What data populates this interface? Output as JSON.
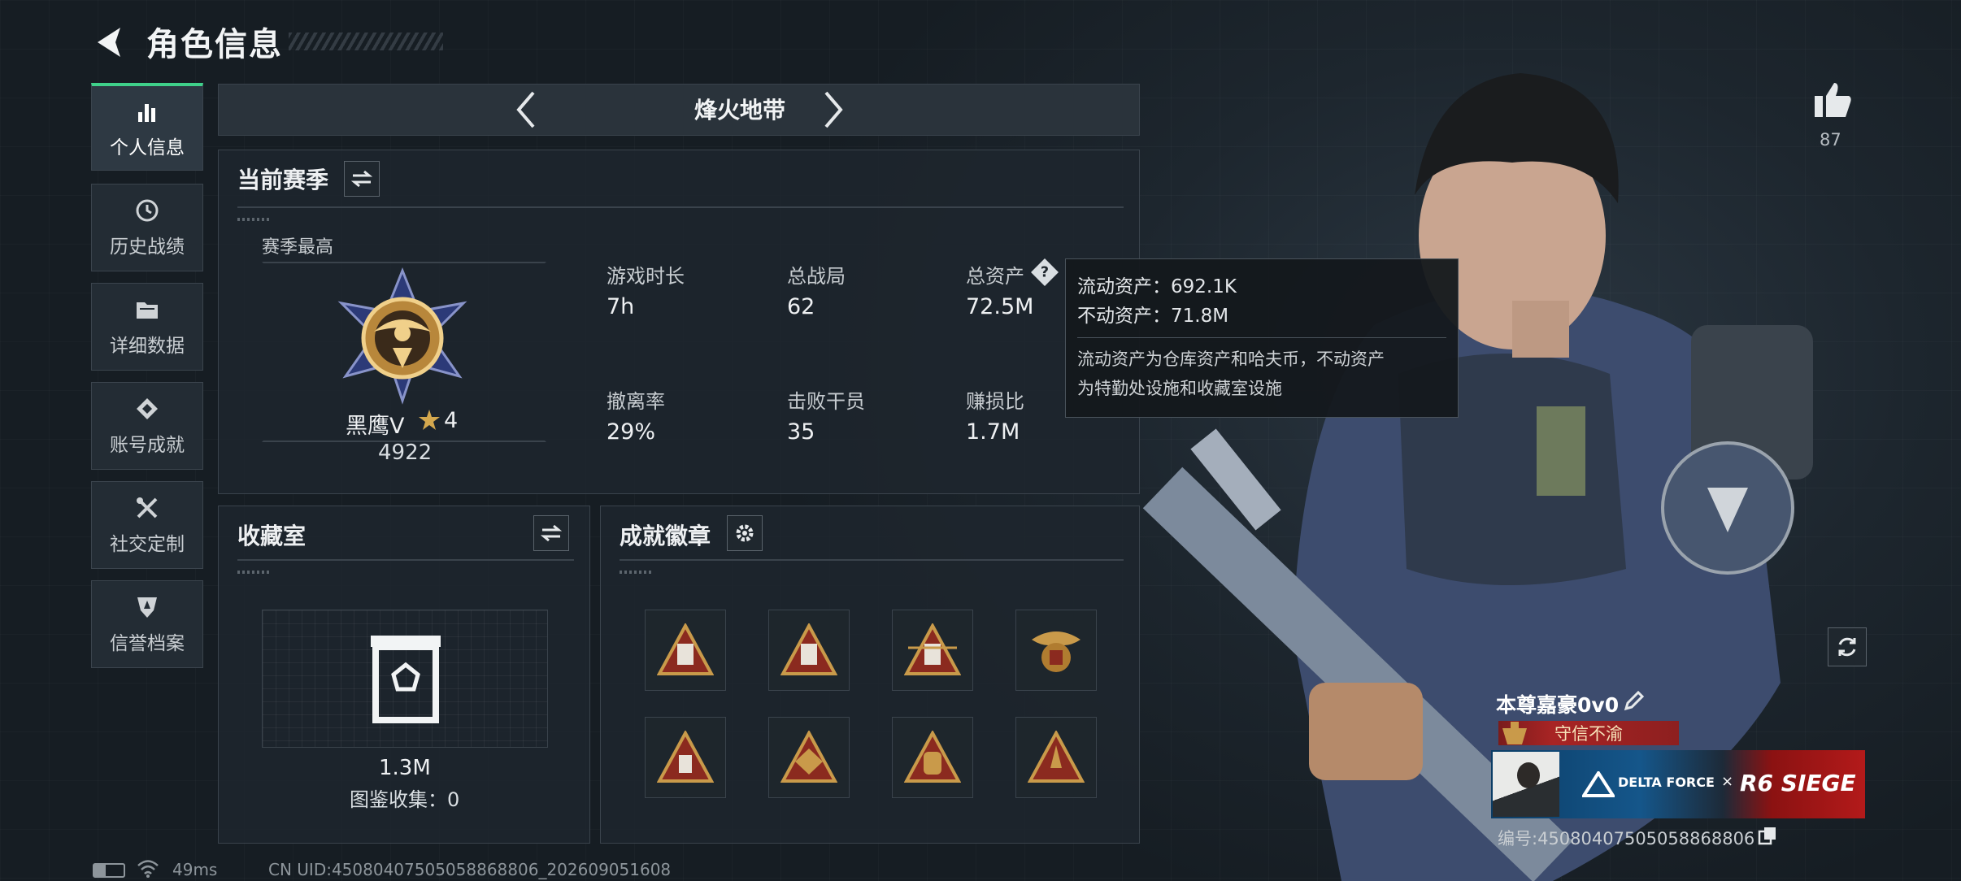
{
  "header": {
    "title": "角色信息"
  },
  "sidebar": {
    "items": [
      {
        "label": "个人信息",
        "icon": "bar-chart-icon",
        "active": true
      },
      {
        "label": "历史战绩",
        "icon": "history-clock-icon"
      },
      {
        "label": "详细数据",
        "icon": "folder-icon"
      },
      {
        "label": "账号成就",
        "icon": "achievement-icon"
      },
      {
        "label": "社交定制",
        "icon": "tools-icon"
      },
      {
        "label": "信誉档案",
        "icon": "shield-icon"
      }
    ]
  },
  "mode": {
    "name": "烽火地带"
  },
  "season": {
    "title": "当前赛季",
    "best_label": "赛季最高",
    "rank_name": "黑鹰V",
    "rank_stars": "4",
    "rank_score": "4922",
    "stats": [
      {
        "label": "游戏时长",
        "value": "7h"
      },
      {
        "label": "总战局",
        "value": "62"
      },
      {
        "label": "总资产",
        "value": "72.5M"
      },
      {
        "label": "撤离率",
        "value": "29%"
      },
      {
        "label": "击败干员",
        "value": "35"
      },
      {
        "label": "赚损比",
        "value": "1.7M"
      }
    ]
  },
  "tooltip": {
    "liquid": "流动资产：692.1K",
    "fixed": "不动资产：71.8M",
    "desc_line1": "流动资产为仓库资产和哈夫币，不动资产",
    "desc_line2": "为特勤处设施和收藏室设施"
  },
  "collection": {
    "title": "收藏室",
    "value": "1.3M",
    "catalog": "图鉴收集：0"
  },
  "badges": {
    "title": "成就徽章",
    "items": [
      "57",
      "58",
      "59",
      "eagle",
      "",
      "",
      "",
      ""
    ]
  },
  "likes": {
    "count": "87"
  },
  "profile": {
    "name": "本尊嘉豪0v0",
    "honor": "守信不渝",
    "banner_left": "DELTA FORCE",
    "banner_x": "×",
    "banner_right": "R6 SIEGE",
    "uid": "编号:450804075050588688​06"
  },
  "footer": {
    "ping": "49ms",
    "cn_uid": "CN UID:45080407505058868806_202609051608"
  },
  "colors": {
    "accent": "#3fd18a",
    "honor_red": "#a82424",
    "gold": "#c99a4a"
  }
}
